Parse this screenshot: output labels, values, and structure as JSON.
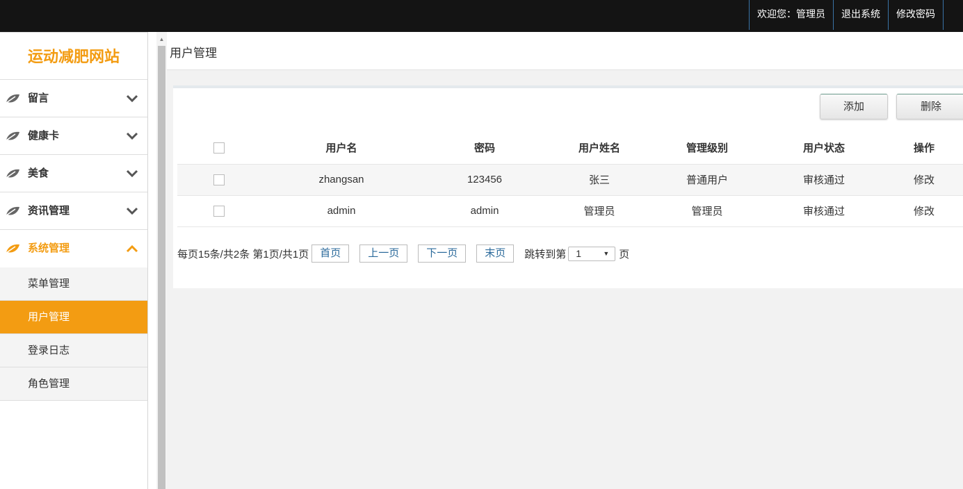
{
  "topbar": {
    "welcome": "欢迎您：管理员",
    "logout": "退出系统",
    "change_password": "修改密码"
  },
  "sidebar": {
    "logo": "运动减肥网站",
    "menus": [
      {
        "label": "留言",
        "expanded": false
      },
      {
        "label": "健康卡",
        "expanded": false
      },
      {
        "label": "美食",
        "expanded": false
      },
      {
        "label": "资讯管理",
        "expanded": false
      },
      {
        "label": "系统管理",
        "expanded": true
      }
    ],
    "sub_items": [
      {
        "label": "菜单管理",
        "selected": false
      },
      {
        "label": "用户管理",
        "selected": true
      },
      {
        "label": "登录日志",
        "selected": false
      },
      {
        "label": "角色管理",
        "selected": false
      }
    ]
  },
  "main": {
    "title": "用户管理",
    "buttons": {
      "add": "添加",
      "delete": "删除"
    },
    "table": {
      "headers": [
        "用户名",
        "密码",
        "用户姓名",
        "管理级别",
        "用户状态",
        "操作"
      ],
      "rows": [
        {
          "username": "zhangsan",
          "password": "123456",
          "name": "张三",
          "level": "普通用户",
          "status": "审核通过",
          "action": "修改"
        },
        {
          "username": "admin",
          "password": "admin",
          "name": "管理员",
          "level": "管理员",
          "status": "审核通过",
          "action": "修改"
        }
      ]
    },
    "pager": {
      "summary": "每页15条/共2条 第1页/共1页",
      "first": "首页",
      "prev": "上一页",
      "next": "下一页",
      "last": "末页",
      "jump_prefix": "跳转到第",
      "jump_value": "1",
      "jump_suffix": "页"
    }
  },
  "colors": {
    "accent": "#f39c12",
    "topbar": "#141414",
    "link": "#2b6a9b"
  },
  "icons": {
    "menu_leaf": "leaf-icon",
    "collapsed": "chevron-down-icon",
    "expanded": "chevron-up-icon",
    "select_arrow": "caret-down-icon"
  }
}
